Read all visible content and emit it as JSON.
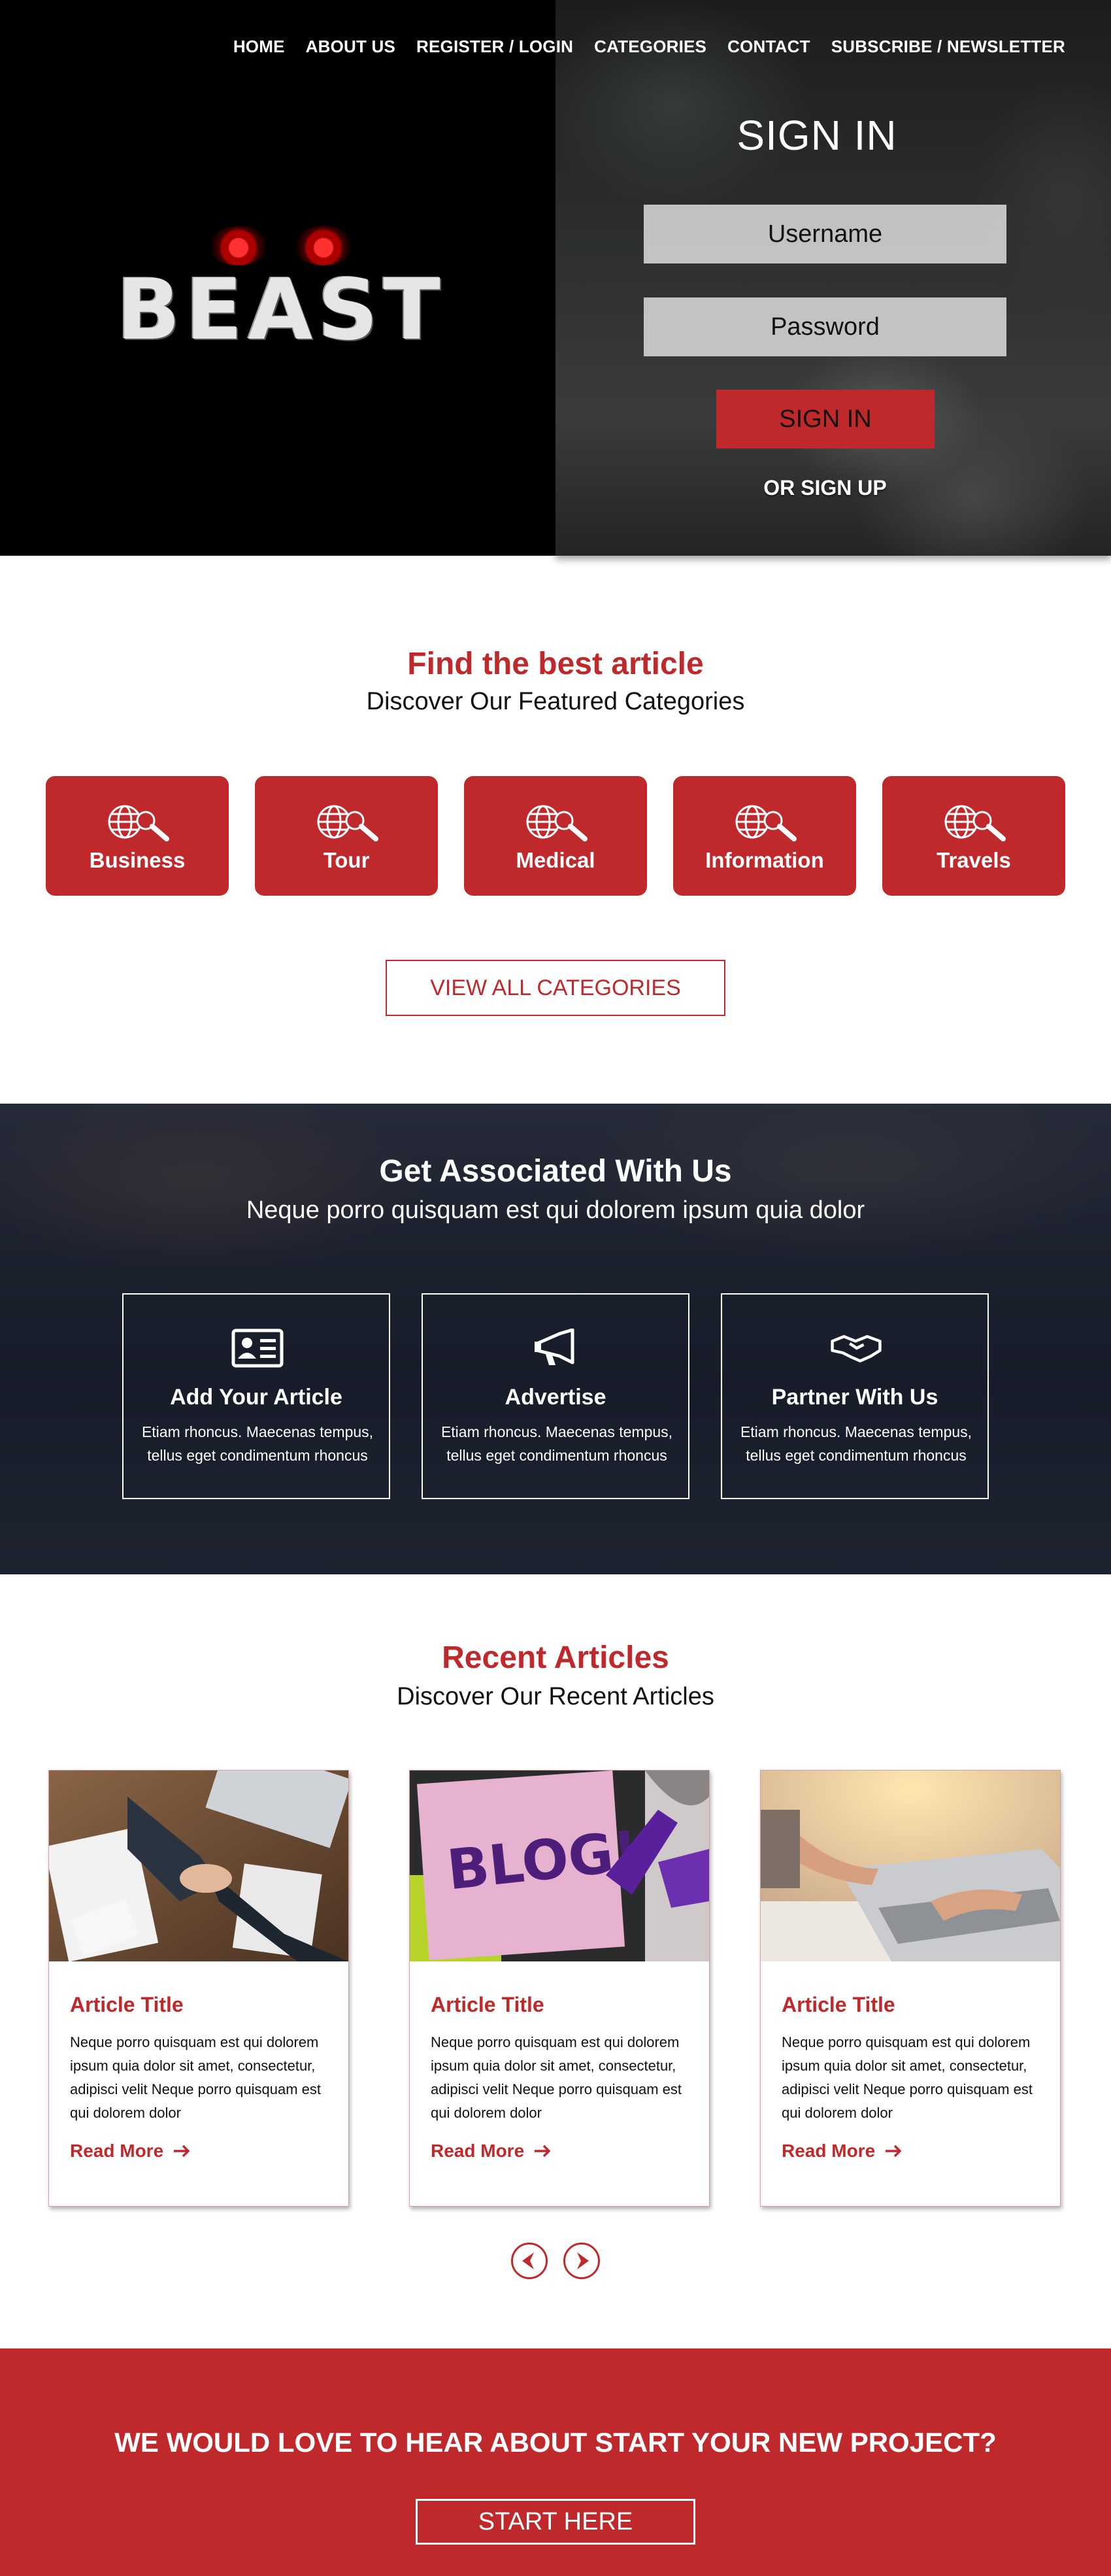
{
  "nav": [
    "HOME",
    "ABOUT US",
    "REGISTER / LOGIN",
    "CATEGORIES",
    "CONTACT",
    "SUBSCRIBE / NEWSLETTER"
  ],
  "logo": {
    "word": "BEAST"
  },
  "signin": {
    "title": "SIGN IN",
    "username_placeholder": "Username",
    "password_placeholder": "Password",
    "button": "SIGN IN",
    "signup": "OR SIGN UP"
  },
  "categories": {
    "title": "Find the best article",
    "subtitle": "Discover Our Featured Categories",
    "items": [
      "Business",
      "Tour",
      "Medical",
      "Information",
      "Travels"
    ],
    "view_all": "VIEW ALL CATEGORIES"
  },
  "associated": {
    "title": "Get Associated With Us",
    "subtitle": "Neque porro quisquam est qui dolorem ipsum quia dolor",
    "boxes": [
      {
        "icon": "id-card-icon",
        "title": "Add Your Article",
        "desc": "Etiam rhoncus. Maecenas tempus, tellus eget condimentum rhoncus"
      },
      {
        "icon": "megaphone-icon",
        "title": "Advertise",
        "desc": "Etiam rhoncus. Maecenas tempus, tellus eget condimentum rhoncus"
      },
      {
        "icon": "handshake-icon",
        "title": "Partner With Us",
        "desc": "Etiam rhoncus. Maecenas tempus, tellus eget condimentum rhoncus"
      }
    ]
  },
  "articles": {
    "title": "Recent Articles",
    "subtitle": "Discover Our Recent Articles",
    "cards": [
      {
        "image": "handshake-desk-photo",
        "title": "Article Title",
        "text": "Neque porro quisquam est qui dolorem ipsum quia dolor sit amet, consectetur, adipisci velit Neque porro quisquam est qui dolorem dolor",
        "link": "Read More"
      },
      {
        "image": "blog-sticky-note-photo",
        "badge": "BLOG!",
        "title": "Article Title",
        "text": "Neque porro quisquam est qui dolorem ipsum quia dolor sit amet, consectetur, adipisci velit Neque porro quisquam est qui dolorem dolor",
        "link": "Read More"
      },
      {
        "image": "laptop-typing-photo",
        "title": "Article Title",
        "text": "Neque porro quisquam est qui dolorem ipsum quia dolor sit amet, consectetur, adipisci velit Neque porro quisquam est qui dolorem dolor",
        "link": "Read More"
      }
    ]
  },
  "cta": {
    "title": "WE WOULD LOVE TO HEAR ABOUT START YOUR NEW PROJECT?",
    "button": "START HERE"
  },
  "colors": {
    "accent": "#c0292c",
    "dark": "#000000",
    "white": "#ffffff"
  }
}
